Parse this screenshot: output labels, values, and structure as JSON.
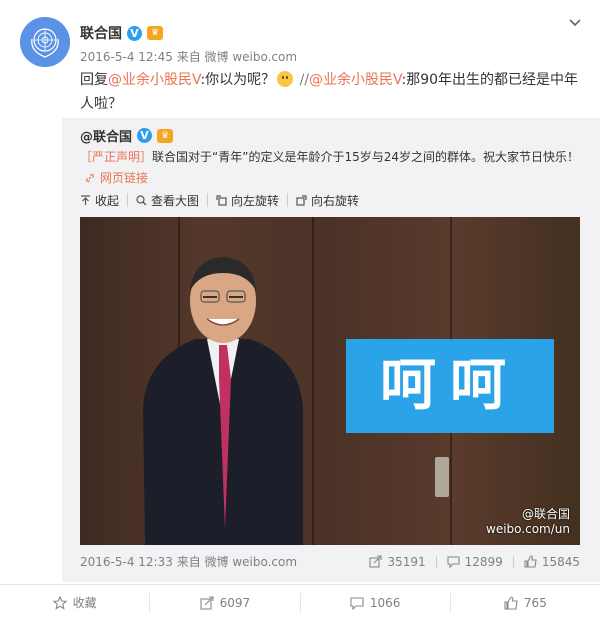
{
  "post": {
    "author": "联合国",
    "meta_time": "2016-5-4 12:45",
    "meta_from": "来自 微博 weibo.com",
    "text_prefix": "回复",
    "mention1": "@业余小股民V",
    "text_mid": ":你以为呢？",
    "text_sep": " //",
    "mention2": "@业余小股民V",
    "text_suffix": ":那90年出生的都已经是中年人啦？"
  },
  "repost": {
    "author": "@联合国",
    "text_bracket": "［严正声明］",
    "text_body": "联合国对于“青年”的定义是年龄介于15岁与24岁之间的群体。祝大家节日快乐！",
    "weblink": "网页链接",
    "tools": [
      "收起",
      "查看大图",
      "向左旋转",
      "向右旋转"
    ],
    "image_overlay_text": "呵呵",
    "watermark_line1": "@联合国",
    "watermark_line2": "weibo.com/un",
    "footer_time": "2016-5-4 12:33",
    "footer_from": "来自 微博 weibo.com",
    "repost_count": "35191",
    "comment_count": "12899",
    "like_count": "15845"
  },
  "actions": {
    "collect": "收藏",
    "forward": "6097",
    "comment": "1066",
    "like": "765"
  },
  "colors": {
    "mention": "#eb7350",
    "verified": "#2a9ef0",
    "overlay_box": "#2aa3e8"
  }
}
